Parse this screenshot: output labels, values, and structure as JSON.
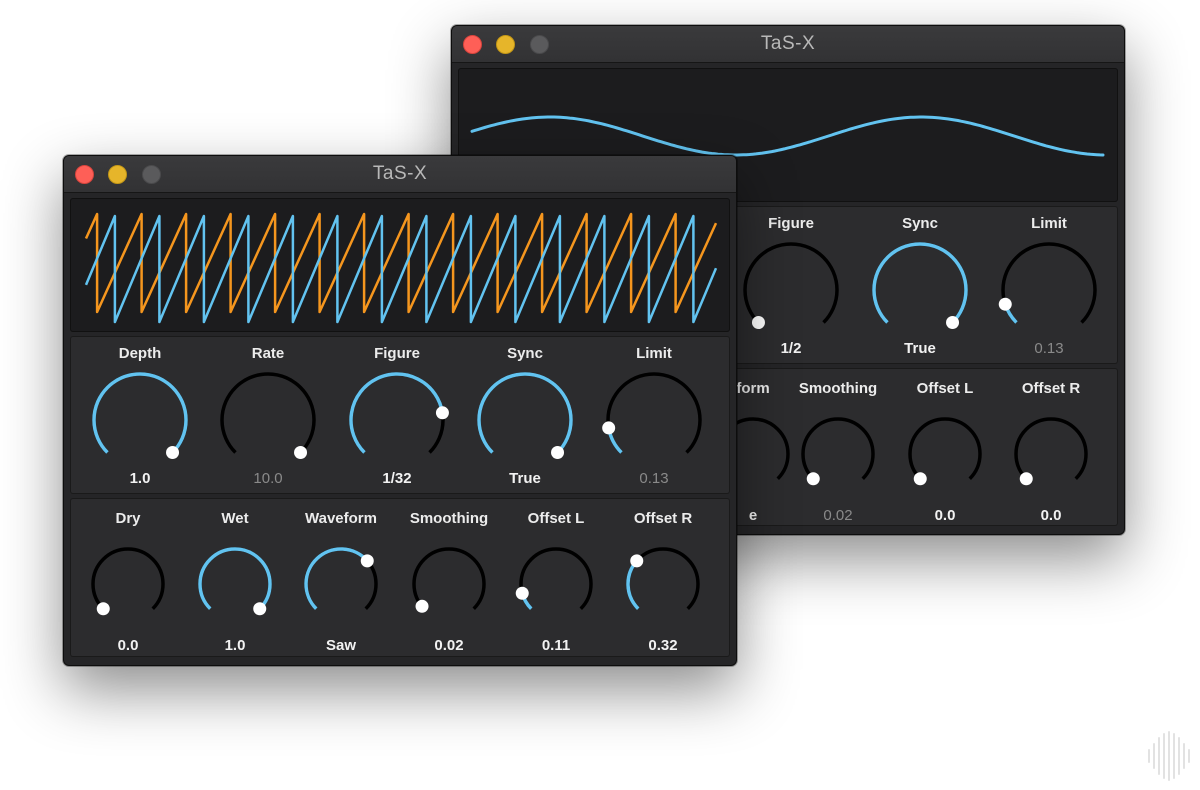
{
  "colors": {
    "accent": "#62c3f0",
    "secondary": "#f5961e",
    "knob_track": "#000000",
    "handle": "#ffffff"
  },
  "back_window": {
    "title": "TaS-X",
    "row1": [
      {
        "label": "Figure",
        "value": "1/2",
        "fraction": 0.0,
        "dim": false
      },
      {
        "label": "Sync",
        "value": "True",
        "fraction": 1.0,
        "dim": false
      },
      {
        "label": "Limit",
        "value": "0.13",
        "fraction": 0.1,
        "dim": true
      }
    ],
    "row2": [
      {
        "label": "form",
        "value": "e",
        "fraction": 0.0,
        "dim": false
      },
      {
        "label": "Smoothing",
        "value": "0.02",
        "fraction": 0.0,
        "dim": true
      },
      {
        "label": "Offset L",
        "value": "0.0",
        "fraction": 0.0,
        "dim": false
      },
      {
        "label": "Offset R",
        "value": "0.0",
        "fraction": 0.0,
        "dim": false
      }
    ]
  },
  "front_window": {
    "title": "TaS-X",
    "row1": [
      {
        "label": "Depth",
        "value": "1.0",
        "fraction": 1.0,
        "dim": false
      },
      {
        "label": "Rate",
        "value": "10.0",
        "fraction": 1.0,
        "dim": true,
        "inactive": true
      },
      {
        "label": "Figure",
        "value": "1/32",
        "fraction": 0.8,
        "dim": false
      },
      {
        "label": "Sync",
        "value": "True",
        "fraction": 1.0,
        "dim": false
      },
      {
        "label": "Limit",
        "value": "0.13",
        "fraction": 0.13,
        "dim": true
      }
    ],
    "row2": [
      {
        "label": "Dry",
        "value": "0.0",
        "fraction": 0.0,
        "dim": false
      },
      {
        "label": "Wet",
        "value": "1.0",
        "fraction": 1.0,
        "dim": false
      },
      {
        "label": "Waveform",
        "value": "Saw",
        "fraction": 0.68,
        "dim": false
      },
      {
        "label": "Smoothing",
        "value": "0.02",
        "fraction": 0.02,
        "dim": false
      },
      {
        "label": "Offset L",
        "value": "0.11",
        "fraction": 0.11,
        "dim": false
      },
      {
        "label": "Offset R",
        "value": "0.32",
        "fraction": 0.32,
        "dim": false
      }
    ]
  }
}
